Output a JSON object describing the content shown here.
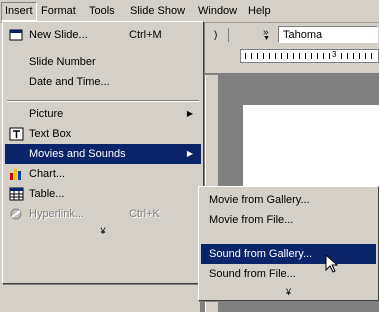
{
  "menubar": {
    "items": [
      {
        "label": "Insert",
        "active": true
      },
      {
        "label": "Format"
      },
      {
        "label": "Tools"
      },
      {
        "label": "Slide Show"
      },
      {
        "label": "Window"
      },
      {
        "label": "Help"
      }
    ]
  },
  "toolbar": {
    "font_name": "Tahoma",
    "chevron": "»",
    "ruler_mark": "3"
  },
  "insert_menu": {
    "items": [
      {
        "label": "New Slide...",
        "shortcut": "Ctrl+M",
        "icon": "new-slide-icon"
      },
      {
        "label": "Slide Number"
      },
      {
        "label": "Date and Time..."
      },
      {
        "label": "Picture",
        "submenu": true
      },
      {
        "label": "Text Box",
        "icon": "text-box-icon"
      },
      {
        "label": "Movies and Sounds",
        "submenu": true,
        "highlighted": true
      },
      {
        "label": "Chart...",
        "icon": "chart-icon"
      },
      {
        "label": "Table...",
        "icon": "table-icon"
      },
      {
        "label": "Hyperlink...",
        "shortcut": "Ctrl+K",
        "disabled": true,
        "icon": "hyperlink-icon"
      }
    ],
    "more": "¥"
  },
  "submenu": {
    "items": [
      {
        "label": "Movie from Gallery..."
      },
      {
        "label": "Movie from File..."
      },
      {
        "label": "Sound from Gallery...",
        "highlighted": true
      },
      {
        "label": "Sound from File..."
      }
    ],
    "more": "¥"
  },
  "colors": {
    "menu_bg": "#d4d0c8",
    "highlight": "#0a246a",
    "workspace": "#808080"
  }
}
